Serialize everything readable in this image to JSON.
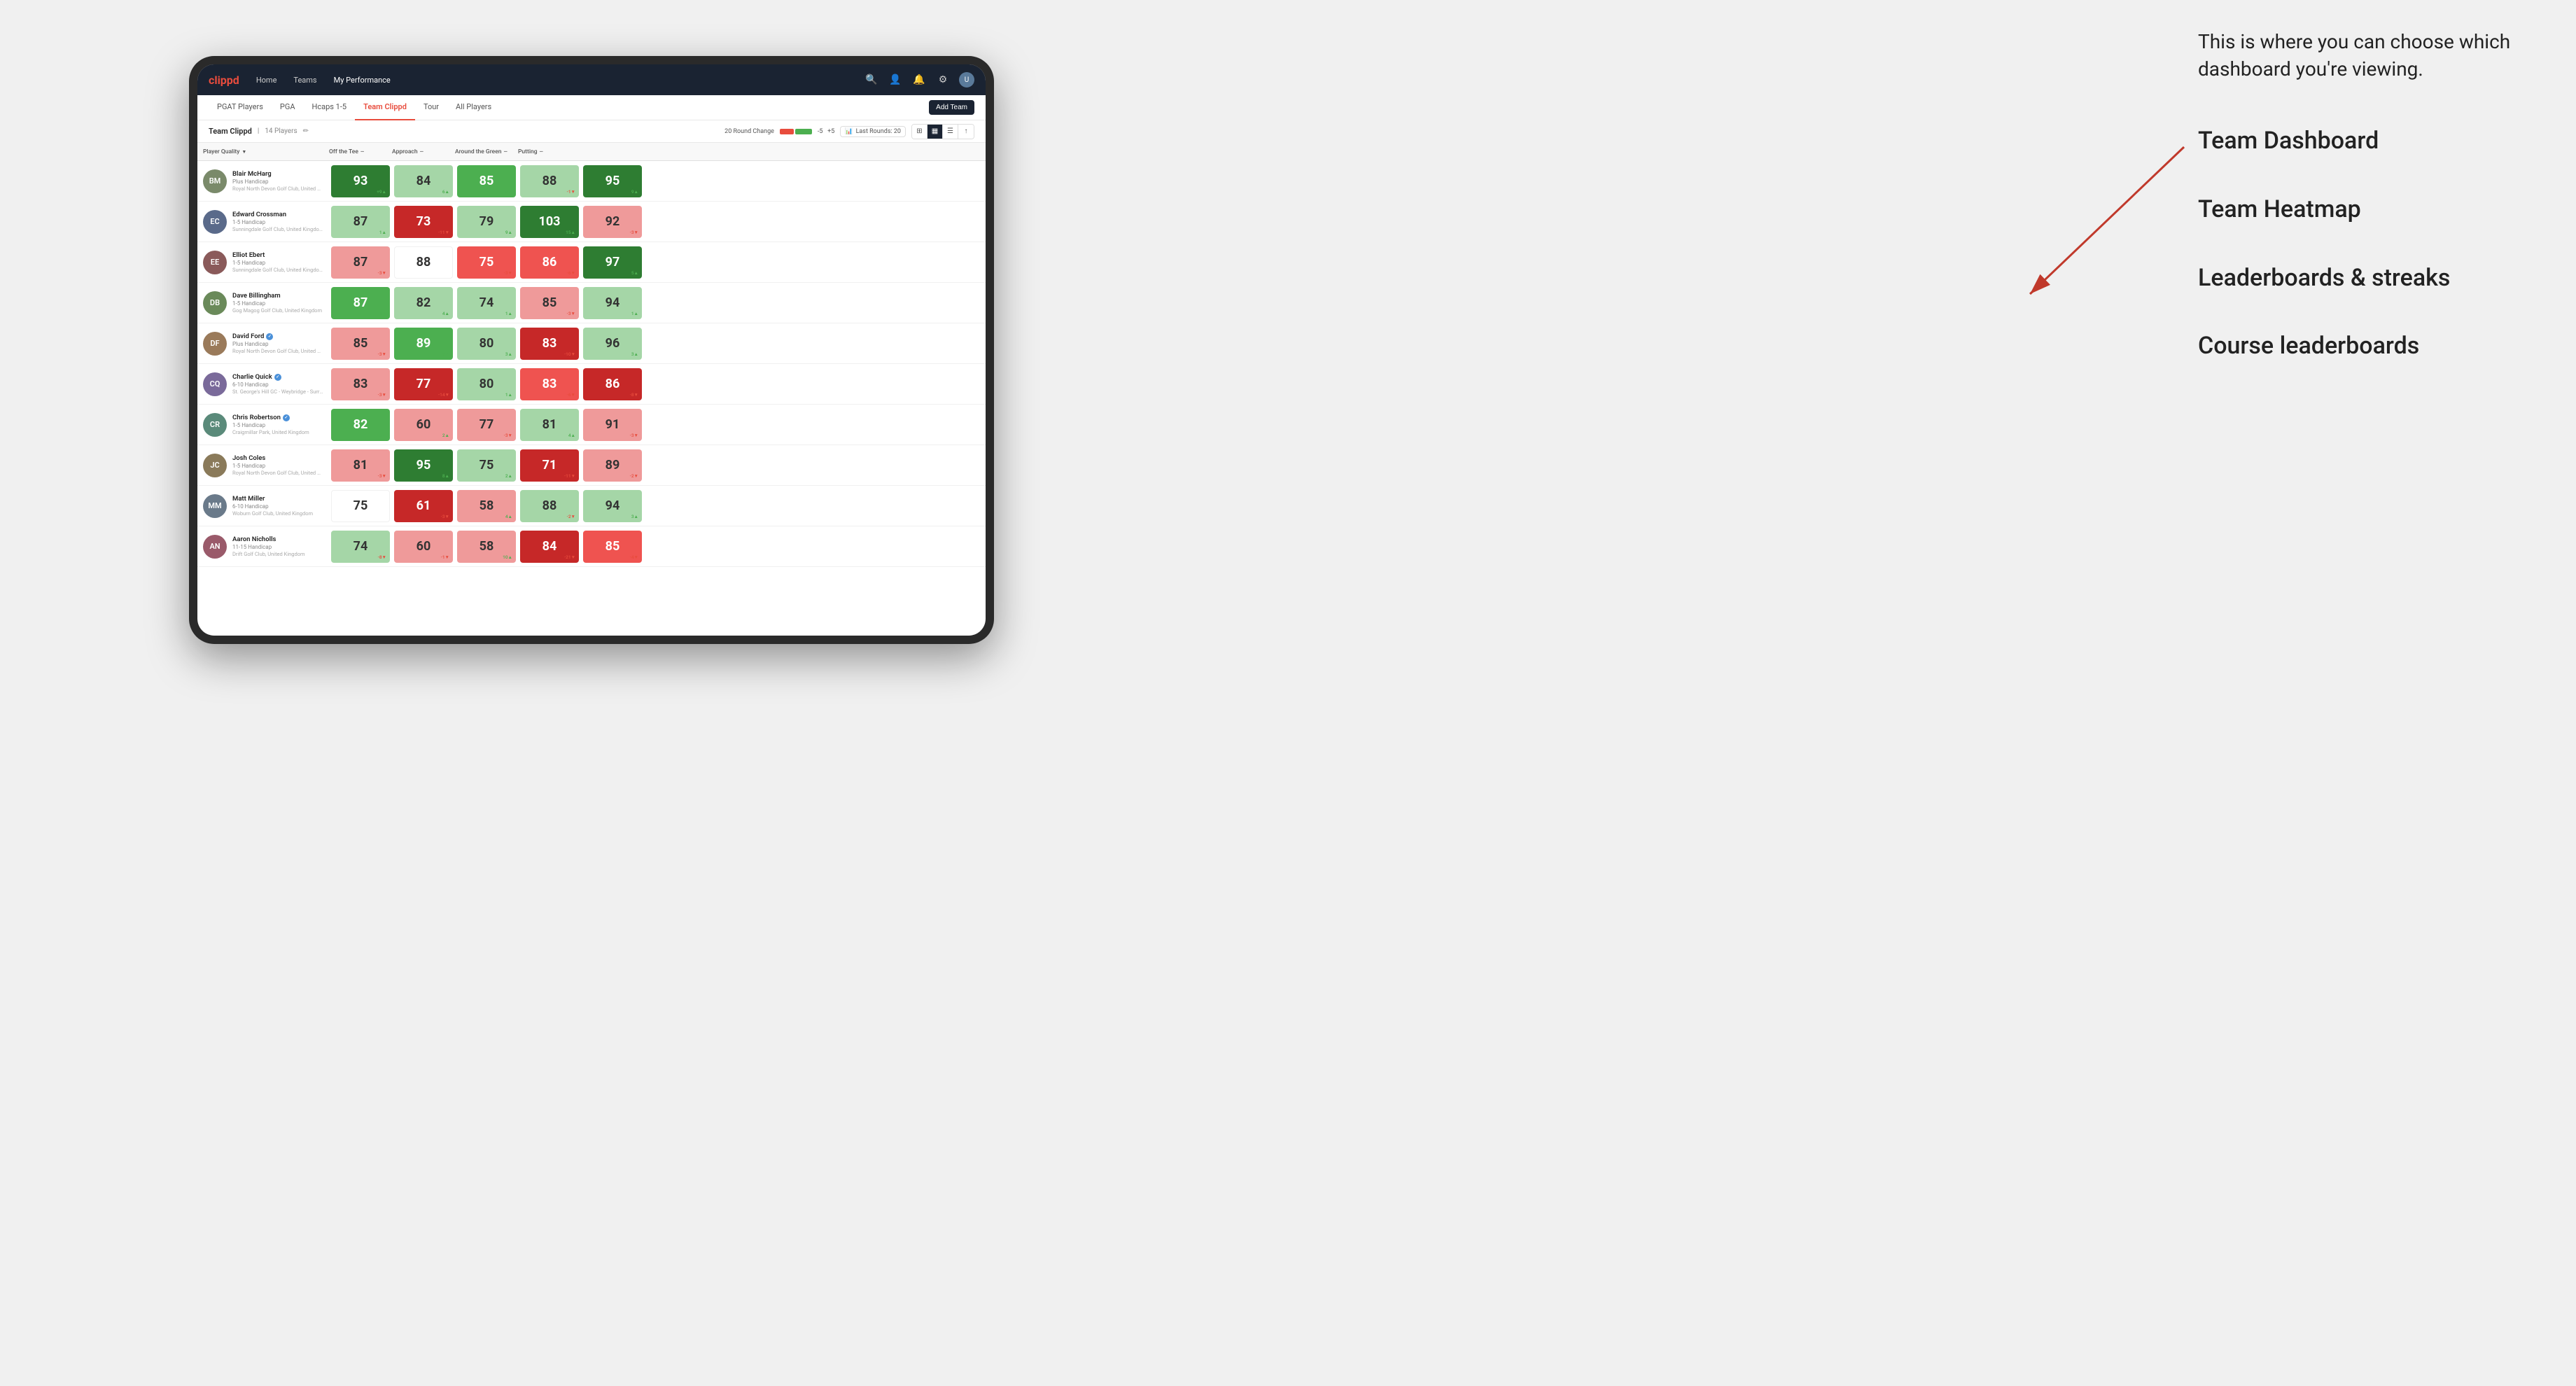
{
  "annotation": {
    "intro": "This is where you can choose which dashboard you're viewing.",
    "options": [
      "Team Dashboard",
      "Team Heatmap",
      "Leaderboards & streaks",
      "Course leaderboards"
    ]
  },
  "navbar": {
    "logo": "clippd",
    "links": [
      "Home",
      "Teams",
      "My Performance"
    ],
    "active_link": "My Performance"
  },
  "subnav": {
    "links": [
      "PGAT Players",
      "PGA",
      "Hcaps 1-5",
      "Team Clippd",
      "Tour",
      "All Players"
    ],
    "active": "Team Clippd",
    "add_button": "Add Team"
  },
  "team_header": {
    "name": "Team Clippd",
    "separator": "|",
    "count": "14 Players",
    "round_change_label": "20 Round Change",
    "neg_val": "-5",
    "pos_val": "+5",
    "last_rounds_label": "Last Rounds:",
    "last_rounds_val": "20"
  },
  "columns": {
    "player": "Player Quality",
    "off_tee": "Off the Tee",
    "approach": "Approach",
    "around_green": "Around the Green",
    "putting": "Putting"
  },
  "players": [
    {
      "name": "Blair McHarg",
      "handicap": "Plus Handicap",
      "club": "Royal North Devon Golf Club, United Kingdom",
      "initials": "BM",
      "avatar_color": "#7a8a6a",
      "scores": {
        "quality": {
          "val": "93",
          "change": "+9",
          "dir": "up",
          "color": "green-dark"
        },
        "off_tee": {
          "val": "84",
          "change": "6▲",
          "dir": "up",
          "color": "green-light"
        },
        "approach": {
          "val": "85",
          "change": "8▲",
          "dir": "up",
          "color": "green-med"
        },
        "around": {
          "val": "88",
          "change": "-1▼",
          "dir": "down",
          "color": "green-light"
        },
        "putting": {
          "val": "95",
          "change": "9▲",
          "dir": "up",
          "color": "green-dark"
        }
      }
    },
    {
      "name": "Edward Crossman",
      "handicap": "1-5 Handicap",
      "club": "Sunningdale Golf Club, United Kingdom",
      "initials": "EC",
      "avatar_color": "#5a6a8a",
      "scores": {
        "quality": {
          "val": "87",
          "change": "1▲",
          "dir": "up",
          "color": "green-light"
        },
        "off_tee": {
          "val": "73",
          "change": "-11▼",
          "dir": "down",
          "color": "red-dark"
        },
        "approach": {
          "val": "79",
          "change": "9▲",
          "dir": "up",
          "color": "green-light"
        },
        "around": {
          "val": "103",
          "change": "15▲",
          "dir": "up",
          "color": "green-dark"
        },
        "putting": {
          "val": "92",
          "change": "-3▼",
          "dir": "down",
          "color": "red-light"
        }
      }
    },
    {
      "name": "Elliot Ebert",
      "handicap": "1-5 Handicap",
      "club": "Sunningdale Golf Club, United Kingdom",
      "initials": "EE",
      "avatar_color": "#8a5a5a",
      "scores": {
        "quality": {
          "val": "87",
          "change": "-3▼",
          "dir": "down",
          "color": "red-light"
        },
        "off_tee": {
          "val": "88",
          "change": "",
          "dir": "none",
          "color": "white"
        },
        "approach": {
          "val": "75",
          "change": "-3▼",
          "dir": "down",
          "color": "red-med"
        },
        "around": {
          "val": "86",
          "change": "-6▼",
          "dir": "down",
          "color": "red-med"
        },
        "putting": {
          "val": "97",
          "change": "5▲",
          "dir": "up",
          "color": "green-dark"
        }
      }
    },
    {
      "name": "Dave Billingham",
      "handicap": "1-5 Handicap",
      "club": "Gog Magog Golf Club, United Kingdom",
      "initials": "DB",
      "avatar_color": "#6a8a5a",
      "scores": {
        "quality": {
          "val": "87",
          "change": "4▲",
          "dir": "up",
          "color": "green-med"
        },
        "off_tee": {
          "val": "82",
          "change": "4▲",
          "dir": "up",
          "color": "green-light"
        },
        "approach": {
          "val": "74",
          "change": "1▲",
          "dir": "up",
          "color": "green-light"
        },
        "around": {
          "val": "85",
          "change": "-3▼",
          "dir": "down",
          "color": "red-light"
        },
        "putting": {
          "val": "94",
          "change": "1▲",
          "dir": "up",
          "color": "green-light"
        }
      }
    },
    {
      "name": "David Ford",
      "handicap": "Plus Handicap",
      "club": "Royal North Devon Golf Club, United Kingdom",
      "initials": "DF",
      "avatar_color": "#9a7a5a",
      "verified": true,
      "scores": {
        "quality": {
          "val": "85",
          "change": "-3▼",
          "dir": "down",
          "color": "red-light"
        },
        "off_tee": {
          "val": "89",
          "change": "7▲",
          "dir": "up",
          "color": "green-med"
        },
        "approach": {
          "val": "80",
          "change": "3▲",
          "dir": "up",
          "color": "green-light"
        },
        "around": {
          "val": "83",
          "change": "-10▼",
          "dir": "down",
          "color": "red-dark"
        },
        "putting": {
          "val": "96",
          "change": "3▲",
          "dir": "up",
          "color": "green-light"
        }
      }
    },
    {
      "name": "Charlie Quick",
      "handicap": "6-10 Handicap",
      "club": "St. George's Hill GC - Weybridge - Surrey, Uni...",
      "initials": "CQ",
      "avatar_color": "#7a6a9a",
      "verified": true,
      "scores": {
        "quality": {
          "val": "83",
          "change": "-3▼",
          "dir": "down",
          "color": "red-light"
        },
        "off_tee": {
          "val": "77",
          "change": "-14▼",
          "dir": "down",
          "color": "red-dark"
        },
        "approach": {
          "val": "80",
          "change": "1▲",
          "dir": "up",
          "color": "green-light"
        },
        "around": {
          "val": "83",
          "change": "-6▼",
          "dir": "down",
          "color": "red-med"
        },
        "putting": {
          "val": "86",
          "change": "-8▼",
          "dir": "down",
          "color": "red-dark"
        }
      }
    },
    {
      "name": "Chris Robertson",
      "handicap": "1-5 Handicap",
      "club": "Craigmillar Park, United Kingdom",
      "initials": "CR",
      "avatar_color": "#5a8a7a",
      "verified": true,
      "scores": {
        "quality": {
          "val": "82",
          "change": "3▲",
          "dir": "up",
          "color": "green-med"
        },
        "off_tee": {
          "val": "60",
          "change": "2▲",
          "dir": "up",
          "color": "red-light"
        },
        "approach": {
          "val": "77",
          "change": "-3▼",
          "dir": "down",
          "color": "red-light"
        },
        "around": {
          "val": "81",
          "change": "4▲",
          "dir": "up",
          "color": "green-light"
        },
        "putting": {
          "val": "91",
          "change": "-3▼",
          "dir": "down",
          "color": "red-light"
        }
      }
    },
    {
      "name": "Josh Coles",
      "handicap": "1-5 Handicap",
      "club": "Royal North Devon Golf Club, United Kingdom",
      "initials": "JC",
      "avatar_color": "#8a7a5a",
      "scores": {
        "quality": {
          "val": "81",
          "change": "-3▼",
          "dir": "down",
          "color": "red-light"
        },
        "off_tee": {
          "val": "95",
          "change": "8▲",
          "dir": "up",
          "color": "green-dark"
        },
        "approach": {
          "val": "75",
          "change": "2▲",
          "dir": "up",
          "color": "green-light"
        },
        "around": {
          "val": "71",
          "change": "-11▼",
          "dir": "down",
          "color": "red-dark"
        },
        "putting": {
          "val": "89",
          "change": "-2▼",
          "dir": "down",
          "color": "red-light"
        }
      }
    },
    {
      "name": "Matt Miller",
      "handicap": "6-10 Handicap",
      "club": "Woburn Golf Club, United Kingdom",
      "initials": "MM",
      "avatar_color": "#6a7a8a",
      "scores": {
        "quality": {
          "val": "75",
          "change": "",
          "dir": "none",
          "color": "white"
        },
        "off_tee": {
          "val": "61",
          "change": "-3▼",
          "dir": "down",
          "color": "red-dark"
        },
        "approach": {
          "val": "58",
          "change": "4▲",
          "dir": "up",
          "color": "red-light"
        },
        "around": {
          "val": "88",
          "change": "-2▼",
          "dir": "down",
          "color": "green-light"
        },
        "putting": {
          "val": "94",
          "change": "3▲",
          "dir": "up",
          "color": "green-light"
        }
      }
    },
    {
      "name": "Aaron Nicholls",
      "handicap": "11-15 Handicap",
      "club": "Drift Golf Club, United Kingdom",
      "initials": "AN",
      "avatar_color": "#9a5a6a",
      "scores": {
        "quality": {
          "val": "74",
          "change": "-8▼",
          "dir": "down",
          "color": "green-light"
        },
        "off_tee": {
          "val": "60",
          "change": "-1▼",
          "dir": "down",
          "color": "red-light"
        },
        "approach": {
          "val": "58",
          "change": "10▲",
          "dir": "up",
          "color": "red-light"
        },
        "around": {
          "val": "84",
          "change": "-21▼",
          "dir": "down",
          "color": "red-dark"
        },
        "putting": {
          "val": "85",
          "change": "-4▼",
          "dir": "down",
          "color": "red-med"
        }
      }
    }
  ]
}
